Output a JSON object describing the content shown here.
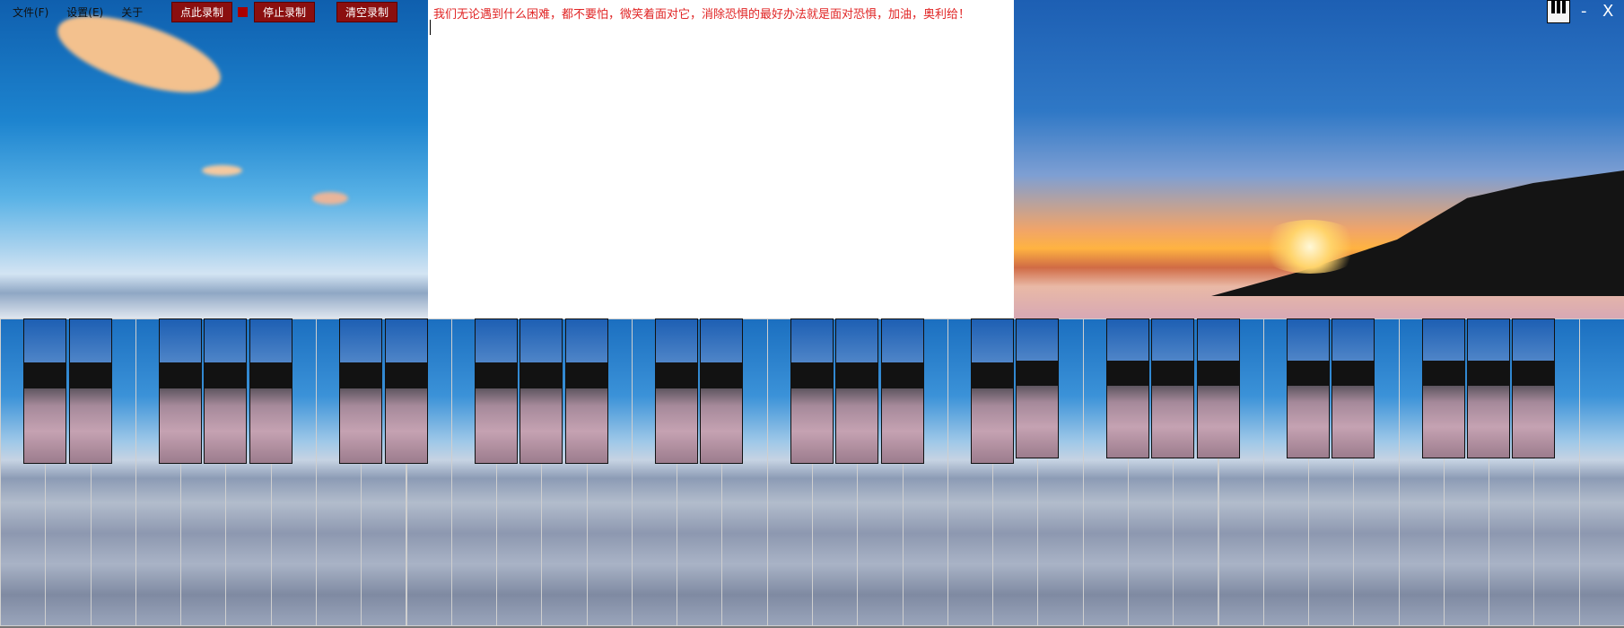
{
  "menu": {
    "file": "文件(F)",
    "settings": "设置(E)",
    "about": "关于"
  },
  "recording": {
    "start": "点此录制",
    "stop": "停止录制",
    "clear": "清空录制"
  },
  "window": {
    "minimize": "-",
    "close": "X"
  },
  "editor": {
    "text": "我们无论遇到什么困难，都不要怕，微笑着面对它，消除恐惧的最好办法就是面对恐惧，加油，奥利给！"
  },
  "keyboard": {
    "white_keys": 36,
    "black_keys": 25
  },
  "colors": {
    "accent": "#8b0f0f",
    "editor_text": "#e02424"
  }
}
